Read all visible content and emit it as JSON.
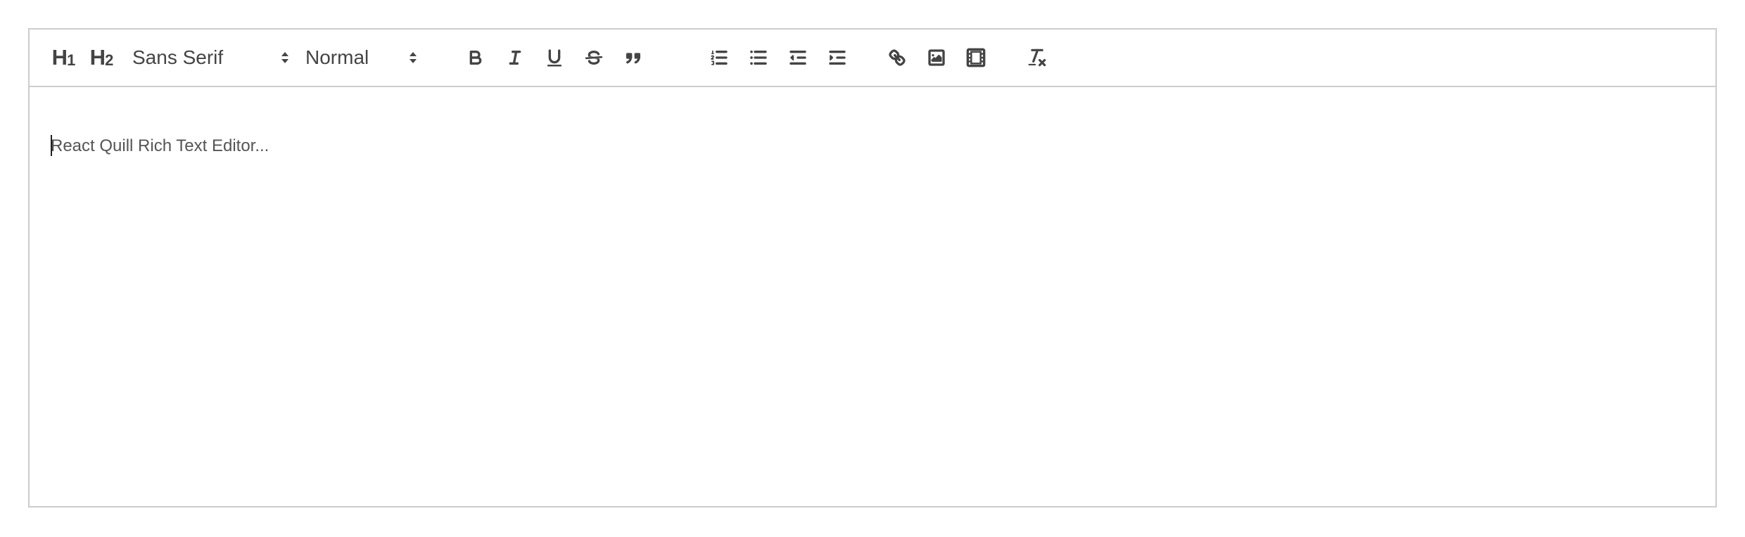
{
  "toolbar": {
    "header1": {
      "main": "H",
      "sub": "1"
    },
    "header2": {
      "main": "H",
      "sub": "2"
    },
    "font_picker": {
      "selected": "Sans Serif"
    },
    "size_picker": {
      "selected": "Normal"
    },
    "icons": [
      "bold-icon",
      "italic-icon",
      "underline-icon",
      "strike-icon",
      "blockquote-icon",
      "ordered-list-icon",
      "bullet-list-icon",
      "outdent-icon",
      "indent-icon",
      "link-icon",
      "image-icon",
      "video-icon",
      "clean-format-icon"
    ]
  },
  "editor": {
    "placeholder": "React Quill Rich Text Editor..."
  },
  "colors": {
    "border": "#cccccc",
    "icon": "#444444"
  }
}
